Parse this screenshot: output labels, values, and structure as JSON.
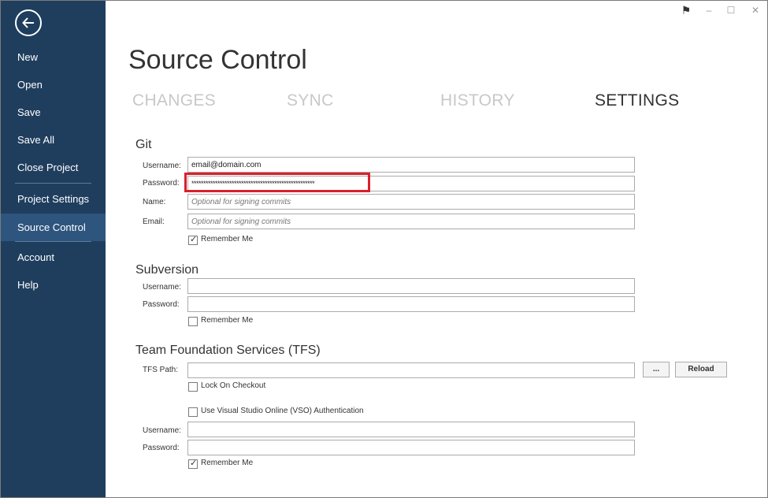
{
  "sidebar": {
    "items": [
      {
        "label": "New"
      },
      {
        "label": "Open"
      },
      {
        "label": "Save"
      },
      {
        "label": "Save All"
      },
      {
        "label": "Close Project"
      },
      {
        "label": "Project Settings"
      },
      {
        "label": "Source Control"
      },
      {
        "label": "Account"
      },
      {
        "label": "Help"
      }
    ],
    "active_item": "Source Control",
    "bg_color": "#1f3e5e",
    "active_color": "#2e557e"
  },
  "titlebar": {
    "flag": "⚑",
    "minimize": "–",
    "maximize": "☐",
    "close": "✕"
  },
  "header": {
    "title": "Source Control",
    "tabs": [
      {
        "label": "CHANGES"
      },
      {
        "label": "SYNC"
      },
      {
        "label": "HISTORY"
      },
      {
        "label": "SETTINGS"
      }
    ],
    "active_tab": "SETTINGS"
  },
  "git": {
    "title": "Git",
    "username_label": "Username:",
    "username_value": "email@domain.com",
    "password_label": "Password:",
    "password_value": "****************************************************",
    "name_label": "Name:",
    "name_placeholder": "Optional for signing commits",
    "email_label": "Email:",
    "email_placeholder": "Optional for signing commits",
    "remember_label": "Remember Me",
    "remember_checked": true
  },
  "subversion": {
    "title": "Subversion",
    "username_label": "Username:",
    "password_label": "Password:",
    "remember_label": "Remember Me",
    "remember_checked": false
  },
  "tfs": {
    "title": "Team Foundation Services (TFS)",
    "path_label": "TFS Path:",
    "browse_label": "...",
    "reload_label": "Reload",
    "lock_label": "Lock On Checkout",
    "lock_checked": false,
    "vso_label": "Use Visual Studio Online (VSO) Authentication",
    "vso_checked": false,
    "username_label": "Username:",
    "password_label": "Password:",
    "remember_label": "Remember Me",
    "remember_checked": true
  },
  "colors": {
    "highlight_border": "#d9202a"
  }
}
